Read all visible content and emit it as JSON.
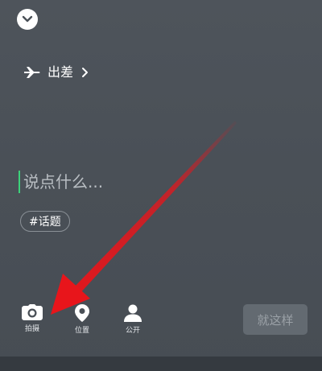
{
  "header": {
    "collapse_icon": "chevron-down-icon"
  },
  "status": {
    "icon": "airplane-icon",
    "label": "出差",
    "chevron_icon": "chevron-right-icon"
  },
  "compose": {
    "placeholder": "说点什么..."
  },
  "topic": {
    "label": "#话题"
  },
  "toolbar": {
    "items": [
      {
        "icon": "camera-icon",
        "label": "拍摄"
      },
      {
        "icon": "location-pin-icon",
        "label": "位置"
      },
      {
        "icon": "person-icon",
        "label": "公开"
      }
    ],
    "confirm_label": "就这样"
  },
  "colors": {
    "background": "#4a5057",
    "caret": "#3cd27a",
    "annotation_arrow": "#e8151b",
    "confirm_button": "#636a71"
  }
}
